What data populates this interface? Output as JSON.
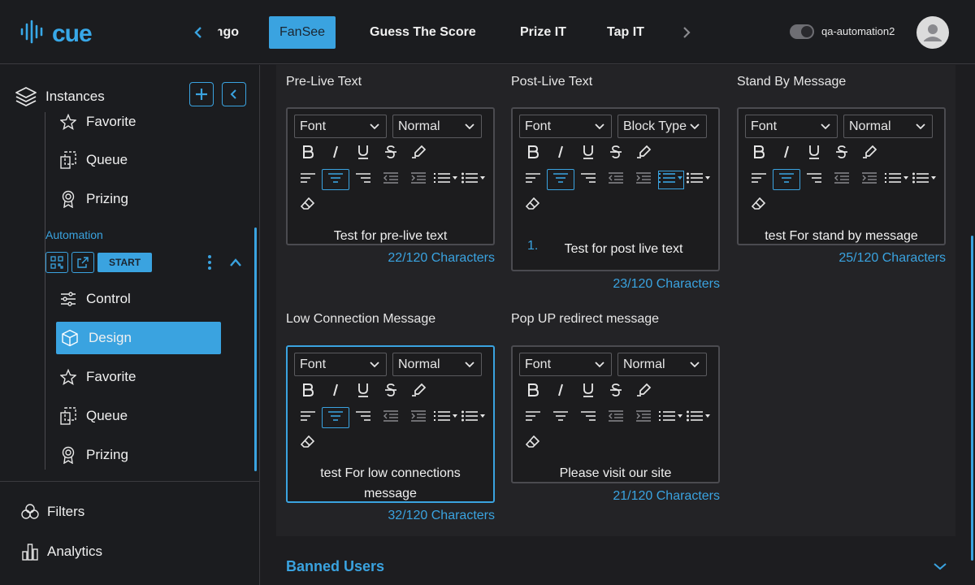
{
  "app": {
    "logo_text": "cue",
    "logo_icon": "sound-wave-icon",
    "accent": "#3aa3e0"
  },
  "header": {
    "tabs": [
      {
        "label": "ngo",
        "active": false
      },
      {
        "label": "FanSee",
        "active": true
      },
      {
        "label": "Guess The Score",
        "active": false
      },
      {
        "label": "Prize IT",
        "active": false
      },
      {
        "label": "Tap IT",
        "active": false
      }
    ],
    "username": "qa-automation2"
  },
  "sidebar": {
    "title": "Instances",
    "top_items": [
      {
        "label": "Favorite",
        "icon": "star-icon"
      },
      {
        "label": "Queue",
        "icon": "queue-icon"
      },
      {
        "label": "Prizing",
        "icon": "award-icon"
      }
    ],
    "section_label": "Automation",
    "start_label": "START",
    "items": [
      {
        "label": "Control",
        "icon": "sliders-icon",
        "active": false
      },
      {
        "label": "Design",
        "icon": "cube-icon",
        "active": true
      },
      {
        "label": "Favorite",
        "icon": "star-icon",
        "active": false
      },
      {
        "label": "Queue",
        "icon": "queue-icon",
        "active": false
      },
      {
        "label": "Prizing",
        "icon": "award-icon",
        "active": false
      }
    ],
    "bottom": [
      {
        "label": "Filters",
        "icon": "filters-icon"
      },
      {
        "label": "Analytics",
        "icon": "analytics-icon"
      }
    ]
  },
  "editors": [
    {
      "label": "Pre-Live Text",
      "font": "Font",
      "style": "Normal",
      "text": "Test for pre-live text",
      "count": "22/120 Characters",
      "list_number": ""
    },
    {
      "label": "Post-Live Text",
      "font": "Font",
      "style": "Block Type",
      "text": "Test for post live text",
      "count": "23/120 Characters",
      "list_number": "1."
    },
    {
      "label": "Stand By Message",
      "font": "Font",
      "style": "Normal",
      "text": "test For stand by message",
      "count": "25/120 Characters",
      "list_number": ""
    },
    {
      "label": "Low Connection Message",
      "font": "Font",
      "style": "Normal",
      "text": "test For low connections message",
      "count": "32/120 Characters",
      "list_number": ""
    },
    {
      "label": "Pop UP redirect message",
      "font": "Font",
      "style": "Normal",
      "text": "Please visit our site",
      "count": "21/120 Characters",
      "list_number": ""
    }
  ],
  "banned_users": {
    "title": "Banned Users"
  }
}
